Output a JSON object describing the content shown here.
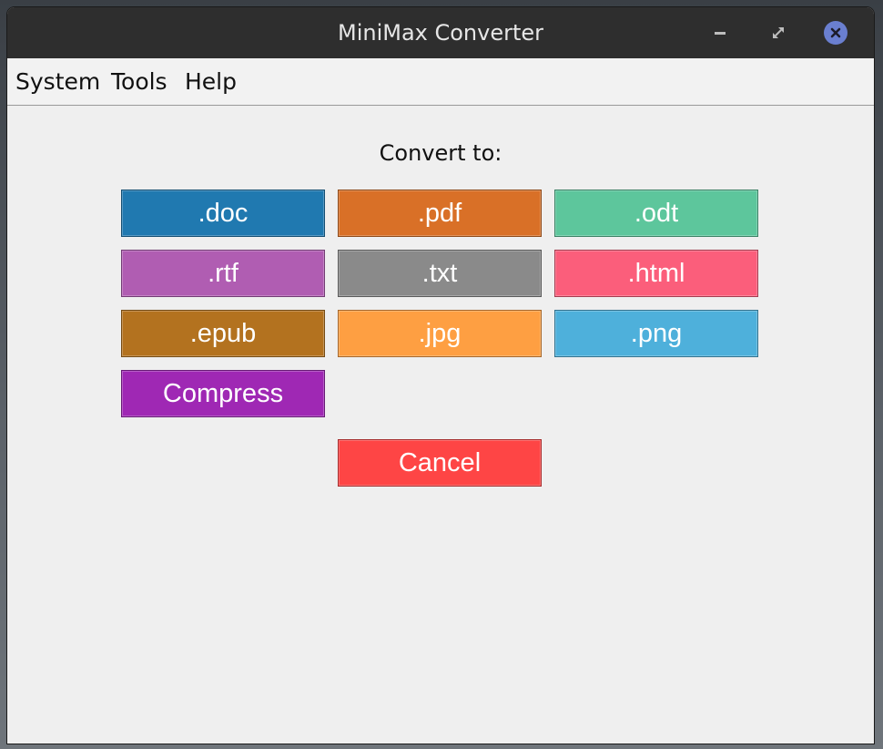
{
  "window": {
    "title": "MiniMax Converter"
  },
  "titlebar": {
    "controls": [
      {
        "name": "minimize-icon"
      },
      {
        "name": "maximize-icon"
      },
      {
        "name": "close-icon",
        "color": "#6a7fd0"
      }
    ]
  },
  "menu": {
    "items": [
      {
        "label": "System"
      },
      {
        "label": "Tools"
      },
      {
        "label": "Help"
      }
    ]
  },
  "main": {
    "heading": "Convert to:",
    "buttons": [
      {
        "label": ".doc",
        "color": "#2079b0"
      },
      {
        "label": ".pdf",
        "color": "#d97027"
      },
      {
        "label": ".odt",
        "color": "#5dc69c"
      },
      {
        "label": ".rtf",
        "color": "#b05db2"
      },
      {
        "label": ".txt",
        "color": "#8a8a8a"
      },
      {
        "label": ".html",
        "color": "#fb5e7b"
      },
      {
        "label": ".epub",
        "color": "#b3721f"
      },
      {
        "label": ".jpg",
        "color": "#fe9f42"
      },
      {
        "label": ".png",
        "color": "#4eb0db"
      },
      {
        "label": "Compress",
        "color": "#9f28b4"
      }
    ],
    "cancel": {
      "label": "Cancel",
      "color": "#fe4545"
    }
  }
}
